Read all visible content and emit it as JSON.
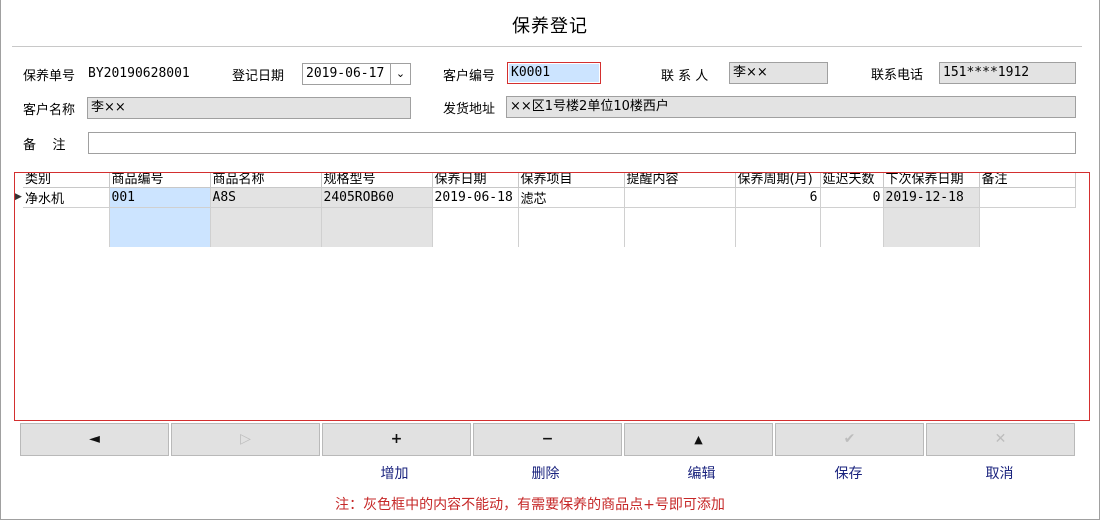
{
  "window": {
    "title": "保养登记"
  },
  "header": {
    "order_label": "保养单号",
    "order_value": "BY20190628001",
    "date_label": "登记日期",
    "date_value": "2019-06-17",
    "customer_code_label": "客户编号",
    "customer_code_value": "K0001",
    "contact_label": "联 系 人",
    "contact_value": "李××",
    "phone_label": "联系电话",
    "phone_value": "151****1912",
    "customer_name_label": "客户名称",
    "customer_name_value": "李××",
    "address_label": "发货地址",
    "address_value": "××区1号楼2单位10楼西户",
    "remark_label": "备    注",
    "remark_value": ""
  },
  "grid": {
    "columns": [
      "类别",
      "商品编号",
      "商品名称",
      "规格型号",
      "保养日期",
      "保养项目",
      "提醒内容",
      "保养周期(月)",
      "延迟天数",
      "下次保养日期",
      "备注"
    ],
    "rows": [
      {
        "category": "净水机",
        "product_code": "001",
        "product_name": "A8S",
        "spec": "2405ROB60",
        "maint_date": "2019-06-18",
        "maint_item": "滤芯",
        "reminder": "",
        "cycle": "6",
        "delay": "0",
        "next_date": "2019-12-18",
        "remark": ""
      }
    ]
  },
  "toolbar": {
    "prev_icon": "◄",
    "next_icon": "▷",
    "add_icon": "+",
    "delete_icon": "−",
    "edit_icon": "▲",
    "save_icon": "✔",
    "cancel_icon": "✕",
    "add_label": "增加",
    "delete_label": "删除",
    "edit_label": "编辑",
    "save_label": "保存",
    "cancel_label": "取消"
  },
  "note": "注：灰色框中的内容不能动，有需要保养的商品点+号即可添加",
  "colors": {
    "focus_border": "#d32f2f",
    "focus_fill": "#cce4ff",
    "readonly_fill": "#e3e3e3",
    "note_text": "#c62828",
    "link_text": "#1a237e"
  }
}
